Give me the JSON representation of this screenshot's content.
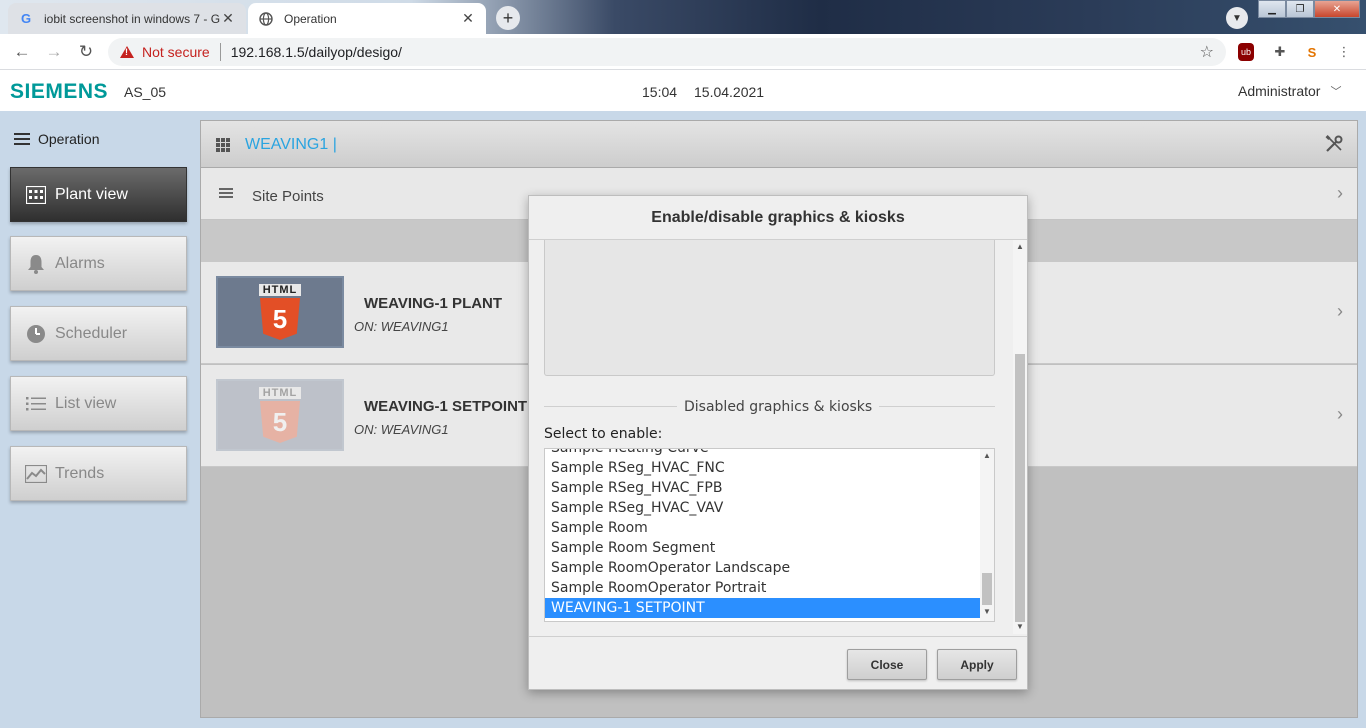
{
  "browser": {
    "tabs": [
      {
        "title": "iobit screenshot in windows 7 - G",
        "favicon": "google-g"
      },
      {
        "title": "Operation",
        "favicon": "globe"
      }
    ],
    "security_label": "Not secure",
    "url": "192.168.1.5/dailyop/desigo/"
  },
  "header": {
    "brand": "SIEMENS",
    "station": "AS_05",
    "time": "15:04",
    "date": "15.04.2021",
    "user": "Administrator",
    "brand_color": "#009999"
  },
  "sidebar": {
    "title": "Operation",
    "items": [
      {
        "label": "Plant view",
        "icon": "grid-icon",
        "active": true
      },
      {
        "label": "Alarms",
        "icon": "bell-icon",
        "active": false
      },
      {
        "label": "Scheduler",
        "icon": "clock-icon",
        "active": false
      },
      {
        "label": "List view",
        "icon": "list-icon",
        "active": false
      },
      {
        "label": "Trends",
        "icon": "chart-icon",
        "active": false
      }
    ]
  },
  "main": {
    "title": "WEAVING1 |",
    "title_color": "#2aa4e0",
    "site_points": "Site Points",
    "plants": [
      {
        "name": "WEAVING-1 PLANT",
        "on": "ON: WEAVING1",
        "thumb_text": "HTML",
        "dimmed": false
      },
      {
        "name": "WEAVING-1 SETPOINT",
        "on": "ON: WEAVING1",
        "thumb_text": "HTML",
        "dimmed": true
      }
    ]
  },
  "modal": {
    "title": "Enable/disable graphics & kiosks",
    "legend": "Disabled graphics & kiosks",
    "select_label": "Select to enable:",
    "options": [
      "Sample Heating Curve",
      "Sample RSeg_HVAC_FNC",
      "Sample RSeg_HVAC_FPB",
      "Sample RSeg_HVAC_VAV",
      "Sample Room",
      "Sample Room Segment",
      "Sample RoomOperator Landscape",
      "Sample RoomOperator Portrait",
      "WEAVING-1 SETPOINT"
    ],
    "selected_option": "WEAVING-1 SETPOINT",
    "close_label": "Close",
    "apply_label": "Apply",
    "selection_color": "#2b8fff"
  }
}
